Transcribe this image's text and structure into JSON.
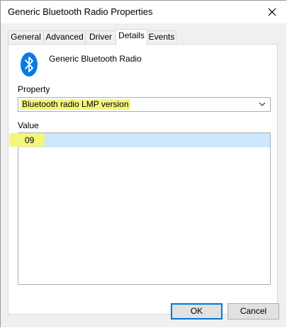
{
  "window": {
    "title": "Generic Bluetooth Radio Properties"
  },
  "tabs": [
    {
      "label": "General",
      "active": false
    },
    {
      "label": "Advanced",
      "active": false
    },
    {
      "label": "Driver",
      "active": false
    },
    {
      "label": "Details",
      "active": true
    },
    {
      "label": "Events",
      "active": false
    }
  ],
  "device": {
    "name": "Generic Bluetooth Radio",
    "icon": "bluetooth-icon"
  },
  "property": {
    "label": "Property",
    "selected": "Bluetooth radio LMP version"
  },
  "value": {
    "label": "Value",
    "items": [
      "09"
    ]
  },
  "buttons": {
    "ok": "OK",
    "cancel": "Cancel"
  },
  "colors": {
    "accent": "#0078d7",
    "selection": "#cce8ff",
    "highlight": "#f5f57a",
    "bluetooth": "#0a7ae2"
  }
}
